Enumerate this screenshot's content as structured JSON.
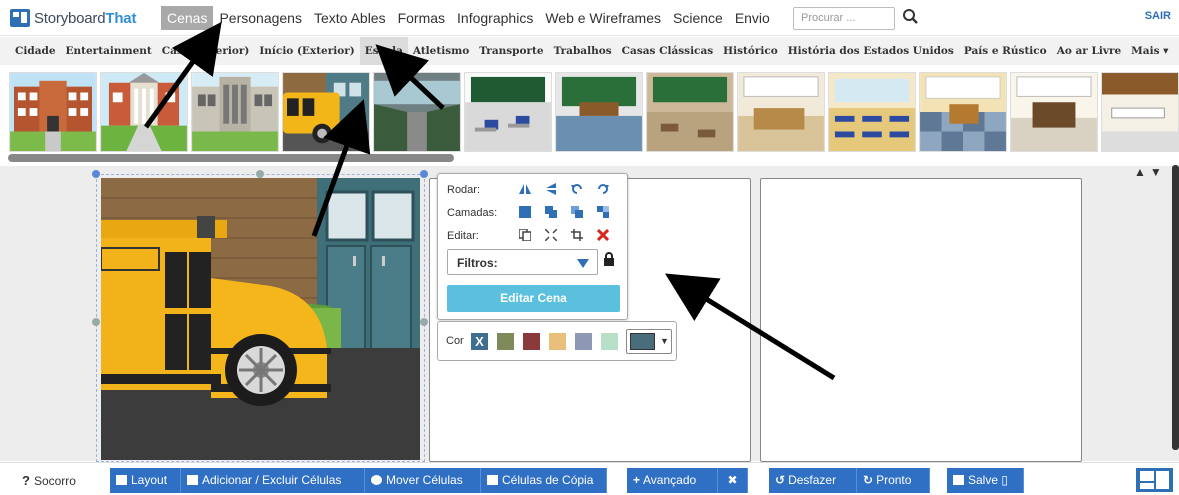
{
  "app": {
    "logo_text_a": "Storyboard",
    "logo_text_b": "That",
    "nav_items": [
      "Cenas",
      "Personagens",
      "Texto Ables",
      "Formas",
      "Infographics",
      "Web e Wireframes",
      "Science",
      "Envio"
    ],
    "search_placeholder": "Procurar ...",
    "sair": "SAIR"
  },
  "subnav": {
    "items": [
      "Cidade",
      "Entertainment",
      "Casa (Interior)",
      "Início (Exterior)",
      "Escola",
      "Atletismo",
      "Transporte",
      "Trabalhos",
      "Casas Clássicas",
      "Histórico",
      "História dos Estados Unidos",
      "País e Rústico",
      "Ao ar Livre",
      "Mais ▾"
    ]
  },
  "popup": {
    "rodar": "Rodar:",
    "camadas": "Camadas:",
    "editar": "Editar:",
    "filtros": "Filtros:",
    "editar_cena": "Editar Cena",
    "cor": "Cor"
  },
  "colors": {
    "swatches": [
      "#3f6f8f",
      "#7f8a5a",
      "#8a3a3a",
      "#e8c07a",
      "#8d98b4",
      "#b8e0c8"
    ]
  },
  "toolbar": {
    "socorro": "Socorro",
    "layout": "Layout",
    "add_remove": "Adicionar / Excluir Células",
    "move": "Mover Células",
    "copy": "Células de Cópia",
    "advanced": "Avançado",
    "undo": "Desfazer",
    "done": "Pronto",
    "save": "Salve ▯"
  }
}
